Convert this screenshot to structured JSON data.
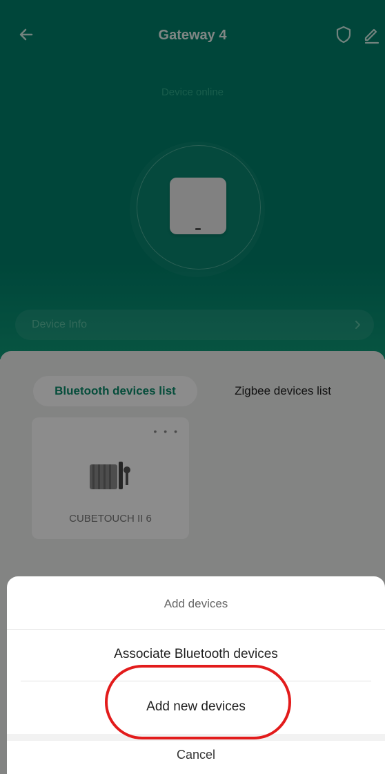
{
  "header": {
    "title": "Gateway 4",
    "status": "Device online",
    "info_label": "Device Info"
  },
  "tabs": {
    "bluetooth": "Bluetooth devices list",
    "zigbee": "Zigbee devices list"
  },
  "device_card": {
    "name": "CUBETOUCH II 6",
    "menu": "• • •"
  },
  "sheet": {
    "title": "Add devices",
    "options": [
      {
        "label": "Associate Bluetooth devices"
      },
      {
        "label": "Add new devices"
      }
    ],
    "cancel": "Cancel"
  },
  "colors": {
    "accent": "#00806a",
    "highlight": "#e21b1b"
  },
  "icons": [
    "back-arrow-icon",
    "shield-icon",
    "edit-icon",
    "chevron-right-icon",
    "gateway-device-image",
    "curtain-robot-image"
  ]
}
